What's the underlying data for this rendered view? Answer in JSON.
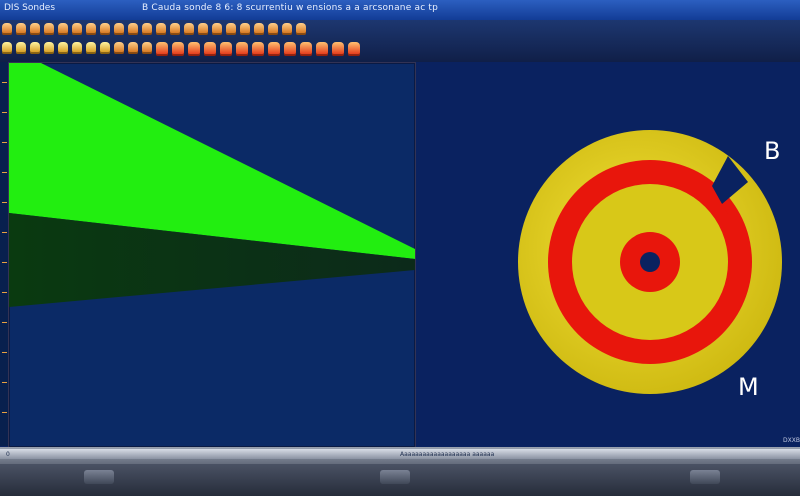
{
  "window": {
    "title": "DIS Sondes",
    "subtitle": "B  Cauda sonde 8 6: 8  scurrentiu w ensions  a  a arcsonane ac tp"
  },
  "toolbar": {
    "top_icons": [
      "tool",
      "tool",
      "tool",
      "tool",
      "tool",
      "tool",
      "tool",
      "tool",
      "tool",
      "tool",
      "tool",
      "tool",
      "tool",
      "tool",
      "tool",
      "tool",
      "tool",
      "tool",
      "tool",
      "tool",
      "tool",
      "tool"
    ],
    "bottom_icons": [
      "tool",
      "tool",
      "tool",
      "tool",
      "tool",
      "tool",
      "tool",
      "tool",
      "tool",
      "tool",
      "tool",
      "tool",
      "tool",
      "tool",
      "tool",
      "tool",
      "tool",
      "tool",
      "tool",
      "tool",
      "tool",
      "tool",
      "tool",
      "tool"
    ]
  },
  "left_panel": {
    "colors": {
      "bright": "#22ee10",
      "dark": "#0a3a10",
      "background": "#0b2a66"
    }
  },
  "right_panel": {
    "label_top": "B",
    "label_bottom": "M",
    "corner_text": "DXXB",
    "colors": {
      "outer": "#e6d21a",
      "ring": "#e8160c",
      "inner": "#d8c818",
      "hole": "#0a2260"
    }
  },
  "status": {
    "left": "0",
    "center": "Aaaaaaaaaaaaaaaaaaa aaaaaa"
  }
}
